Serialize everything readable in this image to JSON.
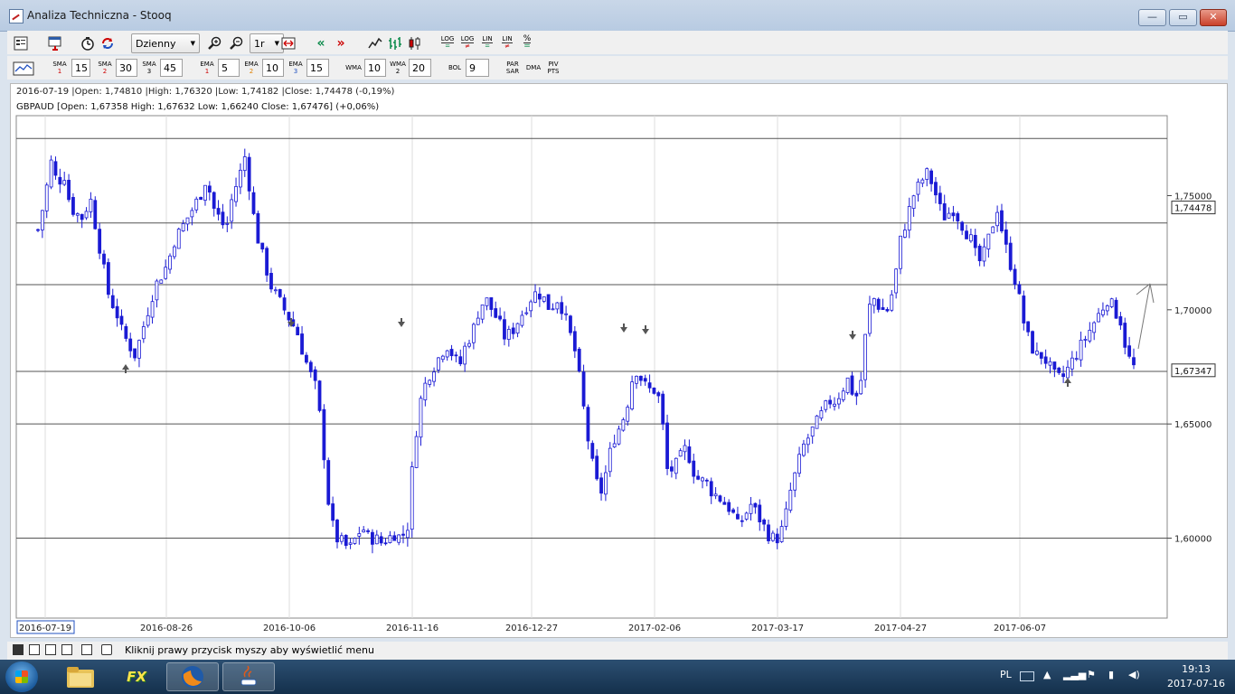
{
  "window": {
    "title": "Analiza Techniczna - Stooq",
    "min_label": "—",
    "max_label": "▭",
    "close_label": "✕"
  },
  "toolbar1": {
    "interval": "Dzienny",
    "period": "1r",
    "log1": "LOG",
    "log2": "LOG",
    "lin1": "LIN",
    "lin2": "LIN",
    "pct": "%"
  },
  "toolbar2": {
    "sma1_label": "SMA",
    "sma1_num": "1",
    "sma1_val": "15",
    "sma2_label": "SMA",
    "sma2_num": "2",
    "sma2_val": "30",
    "sma3_label": "SMA",
    "sma3_num": "3",
    "sma3_val": "45",
    "ema1_label": "EMA",
    "ema1_num": "1",
    "ema1_val": "5",
    "ema2_label": "EMA",
    "ema2_num": "2",
    "ema2_val": "10",
    "ema3_label": "EMA",
    "ema3_num": "3",
    "ema3_val": "15",
    "wma1_label": "WMA",
    "wma1_val": "10",
    "wma2_label": "WMA",
    "wma2_num": "2",
    "wma2_val": "20",
    "bol_label": "BOL",
    "bol_val": "9",
    "par_label": "PAR",
    "sar_label": "SAR",
    "dma_label": "DMA",
    "piv_label": "PIV",
    "pts_label": "PTS"
  },
  "info": {
    "line1": "2016-07-19 |Open: 1,74810 |High: 1,76320 |Low: 1,74182 |Close: 1,74478 (-0,19%)",
    "line2": "GBPAUD [Open: 1,67358  High: 1,67632  Low: 1,66240  Close: 1,67476] (+0,06%)"
  },
  "statusbar": {
    "message": "Kliknij prawy przycisk myszy aby wyświetlić menu"
  },
  "taskbar": {
    "lang": "PL",
    "time": "19:13",
    "date": "2017-07-16",
    "fx_label": "FX"
  },
  "chart_data": {
    "type": "candlestick",
    "symbol": "GBPAUD",
    "y_ticks": [
      "1,75000",
      "1,70000",
      "1,65000",
      "1,60000"
    ],
    "ylim": [
      1.565,
      1.785
    ],
    "x_labels": [
      "2016-07-19",
      "2016-08-26",
      "2016-10-06",
      "2016-11-16",
      "2016-12-27",
      "2017-02-06",
      "2017-03-17",
      "2017-04-27",
      "2017-06-07"
    ],
    "current_label": "1,74478",
    "cursor_label": "1,67347",
    "horizontal_lines": [
      1.775,
      1.738,
      1.711,
      1.673,
      1.65,
      1.6
    ],
    "colors": {
      "candle": "#1a1ad4",
      "grid": "#dddddd",
      "line": "#555555"
    },
    "closes_path": [
      1.735,
      1.748,
      1.765,
      1.755,
      1.76,
      1.745,
      1.742,
      1.74,
      1.75,
      1.735,
      1.72,
      1.705,
      1.7,
      1.69,
      1.685,
      1.68,
      1.69,
      1.7,
      1.71,
      1.715,
      1.72,
      1.73,
      1.735,
      1.74,
      1.745,
      1.75,
      1.758,
      1.745,
      1.74,
      1.735,
      1.75,
      1.758,
      1.768,
      1.745,
      1.73,
      1.72,
      1.71,
      1.705,
      1.7,
      1.695,
      1.69,
      1.68,
      1.672,
      1.665,
      1.64,
      1.61,
      1.6,
      1.598,
      1.595,
      1.6,
      1.605,
      1.6,
      1.6,
      1.598,
      1.6,
      1.602,
      1.6,
      1.605,
      1.64,
      1.66,
      1.67,
      1.675,
      1.68,
      1.685,
      1.68,
      1.675,
      1.685,
      1.69,
      1.7,
      1.705,
      1.7,
      1.695,
      1.688,
      1.69,
      1.695,
      1.7,
      1.705,
      1.708,
      1.705,
      1.7,
      1.705,
      1.7,
      1.69,
      1.68,
      1.66,
      1.64,
      1.625,
      1.62,
      1.635,
      1.645,
      1.65,
      1.66,
      1.675,
      1.67,
      1.665,
      1.665,
      1.66,
      1.63,
      1.63,
      1.635,
      1.64,
      1.63,
      1.625,
      1.625,
      1.62,
      1.618,
      1.615,
      1.612,
      1.605,
      1.61,
      1.615,
      1.61,
      1.605,
      1.6,
      1.6,
      1.605,
      1.62,
      1.63,
      1.64,
      1.645,
      1.65,
      1.655,
      1.66,
      1.66,
      1.665,
      1.67,
      1.66,
      1.67,
      1.7,
      1.705,
      1.7,
      1.7,
      1.71,
      1.73,
      1.74,
      1.75,
      1.755,
      1.76,
      1.755,
      1.745,
      1.74,
      1.745,
      1.74,
      1.735,
      1.73,
      1.72,
      1.725,
      1.735,
      1.745,
      1.73,
      1.72,
      1.71,
      1.695,
      1.685,
      1.68,
      1.68,
      1.675,
      1.67,
      1.67,
      1.675,
      1.68,
      1.685,
      1.69,
      1.695,
      1.7,
      1.705,
      1.7,
      1.695,
      1.68,
      1.675
    ]
  }
}
